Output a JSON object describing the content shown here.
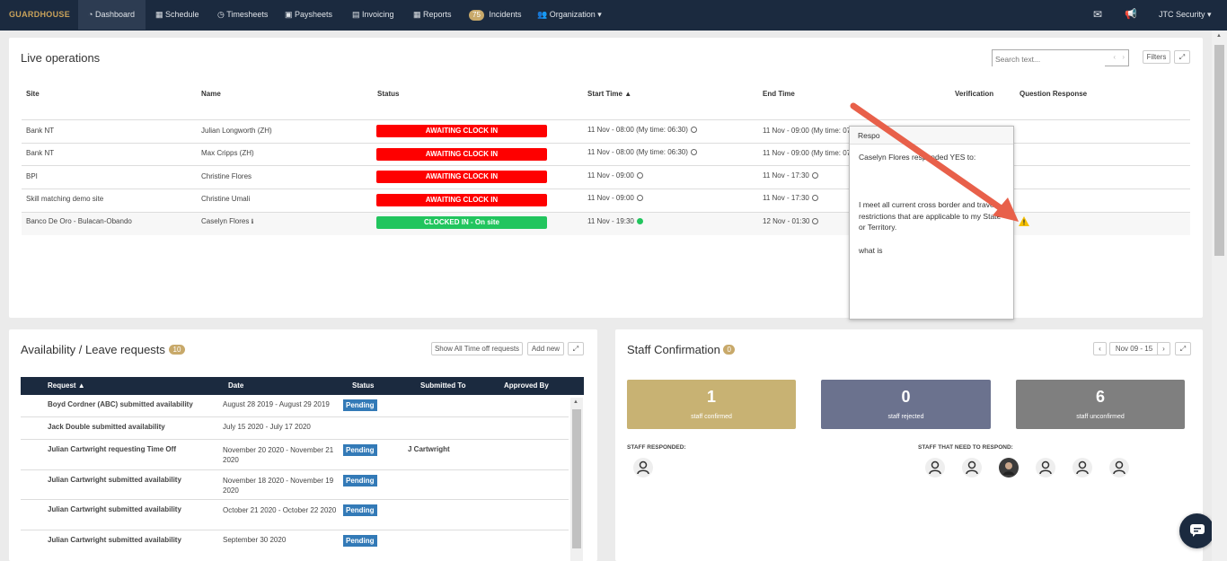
{
  "nav": {
    "logo": "GUARDHOUSE",
    "items": [
      {
        "label": "Dashboard",
        "icon": "dashboard-icon"
      },
      {
        "label": "Schedule",
        "icon": "calendar-icon"
      },
      {
        "label": "Timesheets",
        "icon": "clock-icon"
      },
      {
        "label": "Paysheets",
        "icon": "money-icon"
      },
      {
        "label": "Invoicing",
        "icon": "invoice-icon"
      },
      {
        "label": "Reports",
        "icon": "table-icon"
      },
      {
        "label": "Incidents",
        "badge": "75"
      },
      {
        "label": "Organization",
        "icon": "users-icon"
      }
    ],
    "account": "JTC Security"
  },
  "live_ops": {
    "title": "Live operations",
    "search_placeholder": "Search text...",
    "filters_label": "Filters",
    "columns": [
      "Site",
      "Name",
      "Status",
      "Start Time ▲",
      "End Time",
      "Verification",
      "Question Response"
    ],
    "rows": [
      {
        "site": "Bank NT",
        "name": "Julian Longworth (ZH)",
        "status": "AWAITING CLOCK IN",
        "status_color": "#fe0000",
        "start": "11 Nov - 08:00 (My time: 06:30)",
        "end": "11 Nov - 09:00 (My time: 07"
      },
      {
        "site": "Bank NT",
        "name": "Max Cripps (ZH)",
        "status": "AWAITING CLOCK IN",
        "status_color": "#fe0000",
        "start": "11 Nov - 08:00 (My time: 06:30)",
        "end": "11 Nov - 09:00 (My time: 07"
      },
      {
        "site": "BPI",
        "name": "Christine Flores",
        "status": "AWAITING CLOCK IN",
        "status_color": "#fe0000",
        "start": "11 Nov - 09:00",
        "end": "11 Nov - 17:30"
      },
      {
        "site": "Skill matching demo site",
        "name": "Christine Umali",
        "status": "AWAITING CLOCK IN",
        "status_color": "#fe0000",
        "start": "11 Nov - 09:00",
        "end": "11 Nov - 17:30"
      },
      {
        "site": "Banco De Oro - Bulacan-Obando",
        "name": "Caselyn Flores",
        "status": "CLOCKED IN - On site",
        "status_color": "#22c55e",
        "start": "11 Nov - 19:30",
        "end": "12 Nov - 01:30"
      }
    ],
    "popover": {
      "title": "Respo",
      "line1": "Caselyn Flores responded YES to:",
      "body": "I meet all current cross border and travel restrictions that are applicable to my State or Territory.",
      "extra": "what is"
    }
  },
  "availability": {
    "title": "Availability / Leave requests",
    "badge": "10",
    "show_all_label": "Show All Time off requests",
    "add_new_label": "Add new",
    "columns": [
      "Request ▲",
      "Date",
      "Status",
      "Submitted To",
      "Approved By"
    ],
    "rows": [
      {
        "request": "Boyd Cordner (ABC) submitted availability",
        "date": "August 28 2019 - August 29 2019",
        "status": "Pending",
        "submitted_to": ""
      },
      {
        "request": "Jack Double submitted availability",
        "date": "July 15 2020 - July 17 2020",
        "status": "",
        "submitted_to": ""
      },
      {
        "request": "Julian Cartwright requesting Time Off",
        "date": "November 20 2020 - November 21 2020",
        "status": "Pending",
        "submitted_to": "J Cartwright"
      },
      {
        "request": "Julian Cartwright submitted availability",
        "date": "November 18 2020 - November 19 2020",
        "status": "Pending",
        "submitted_to": ""
      },
      {
        "request": "Julian Cartwright submitted availability",
        "date": "October 21 2020 - October 22 2020",
        "status": "Pending",
        "submitted_to": ""
      },
      {
        "request": "Julian Cartwright submitted availability",
        "date": "September 30 2020",
        "status": "Pending",
        "submitted_to": ""
      }
    ]
  },
  "staff": {
    "title": "Staff Confirmation",
    "badge": "0",
    "date_range": "Nov 09 - 15",
    "boxes": [
      {
        "num": "1",
        "label": "staff confirmed",
        "color": "#c8b273"
      },
      {
        "num": "0",
        "label": "staff rejected",
        "color": "#6b728e"
      },
      {
        "num": "6",
        "label": "staff unconfirmed",
        "color": "#7f7f7f"
      }
    ],
    "responded_label": "STAFF RESPONDED:",
    "need_label": "STAFF THAT NEED TO RESPOND:"
  }
}
